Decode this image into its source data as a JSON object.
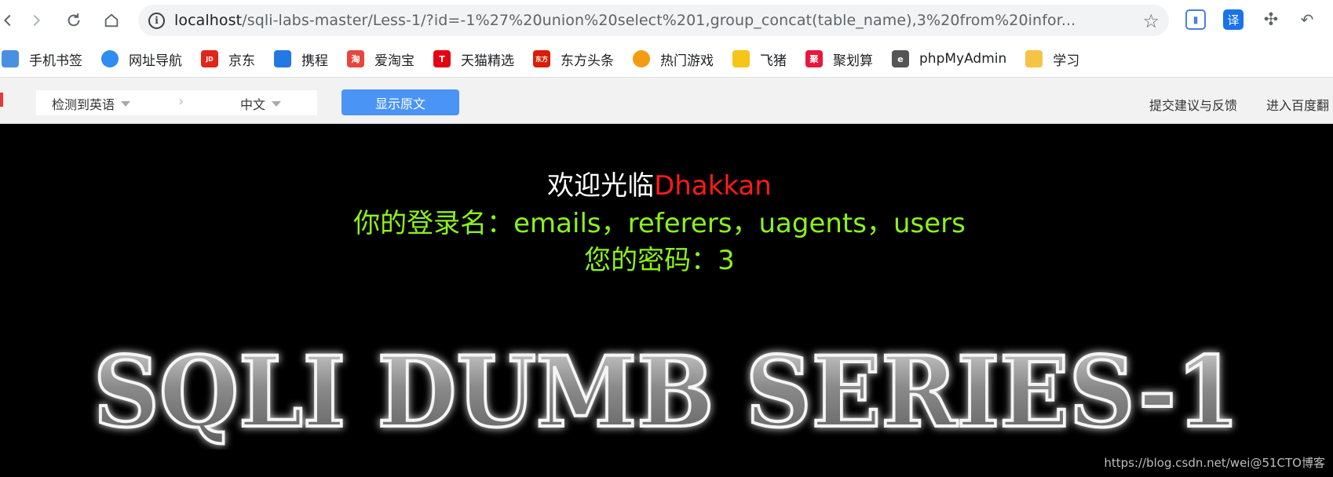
{
  "address_bar": {
    "url_host": "localhost",
    "url_rest": "/sqli-labs-master/Less-1/?id=-1%27%20union%20select%201,group_concat(table_name),3%20from%20infor..."
  },
  "extensions": {
    "translate_label": "译"
  },
  "bookmarks": [
    {
      "label": "手机书签",
      "icon": "phone-bookmark-icon",
      "color": "#4a90e2",
      "glyph": ""
    },
    {
      "label": "网址导航",
      "icon": "nav-icon",
      "color": "#2f8cf0",
      "glyph": ""
    },
    {
      "label": "京东",
      "icon": "jd-icon",
      "color": "#e1251b",
      "glyph": "JD"
    },
    {
      "label": "携程",
      "icon": "ctrip-icon",
      "color": "#2577e3",
      "glyph": ""
    },
    {
      "label": "爱淘宝",
      "icon": "taobao-icon",
      "color": "#e8453c",
      "glyph": "淘"
    },
    {
      "label": "天猫精选",
      "icon": "tmall-icon",
      "color": "#e50012",
      "glyph": "T"
    },
    {
      "label": "东方头条",
      "icon": "dftt-icon",
      "color": "#d81e06",
      "glyph": "东方"
    },
    {
      "label": "热门游戏",
      "icon": "games-icon",
      "color": "#f39c12",
      "glyph": ""
    },
    {
      "label": "飞猪",
      "icon": "fliggy-icon",
      "color": "#f5c518",
      "glyph": ""
    },
    {
      "label": "聚划算",
      "icon": "juhuasuan-icon",
      "color": "#e8173c",
      "glyph": "聚"
    },
    {
      "label": "phpMyAdmin",
      "icon": "phpmyadmin-icon",
      "color": "#555555",
      "glyph": "e"
    },
    {
      "label": "学习",
      "icon": "folder-icon",
      "color": "#f6c445",
      "glyph": ""
    }
  ],
  "translate_bar": {
    "source_lang": "检测到英语",
    "target_lang": "中文",
    "show_original": "显示原文",
    "feedback": "提交建议与反馈",
    "enter_baidu": "进入百度翻"
  },
  "page": {
    "welcome_prefix": "欢迎光临",
    "welcome_name": "Dhakkan",
    "login_line": "你的登录名：emails，referers，uagents，users",
    "password_line": "您的密码：3",
    "banner_text": "SQLI DUMB SERIES-1",
    "watermark": "https://blog.csdn.net/wei@51CTO博客"
  },
  "colors": {
    "welcome_name": "#ff1a1a",
    "result_text": "#8bf21a",
    "show_original_button": "#4a94f5"
  }
}
